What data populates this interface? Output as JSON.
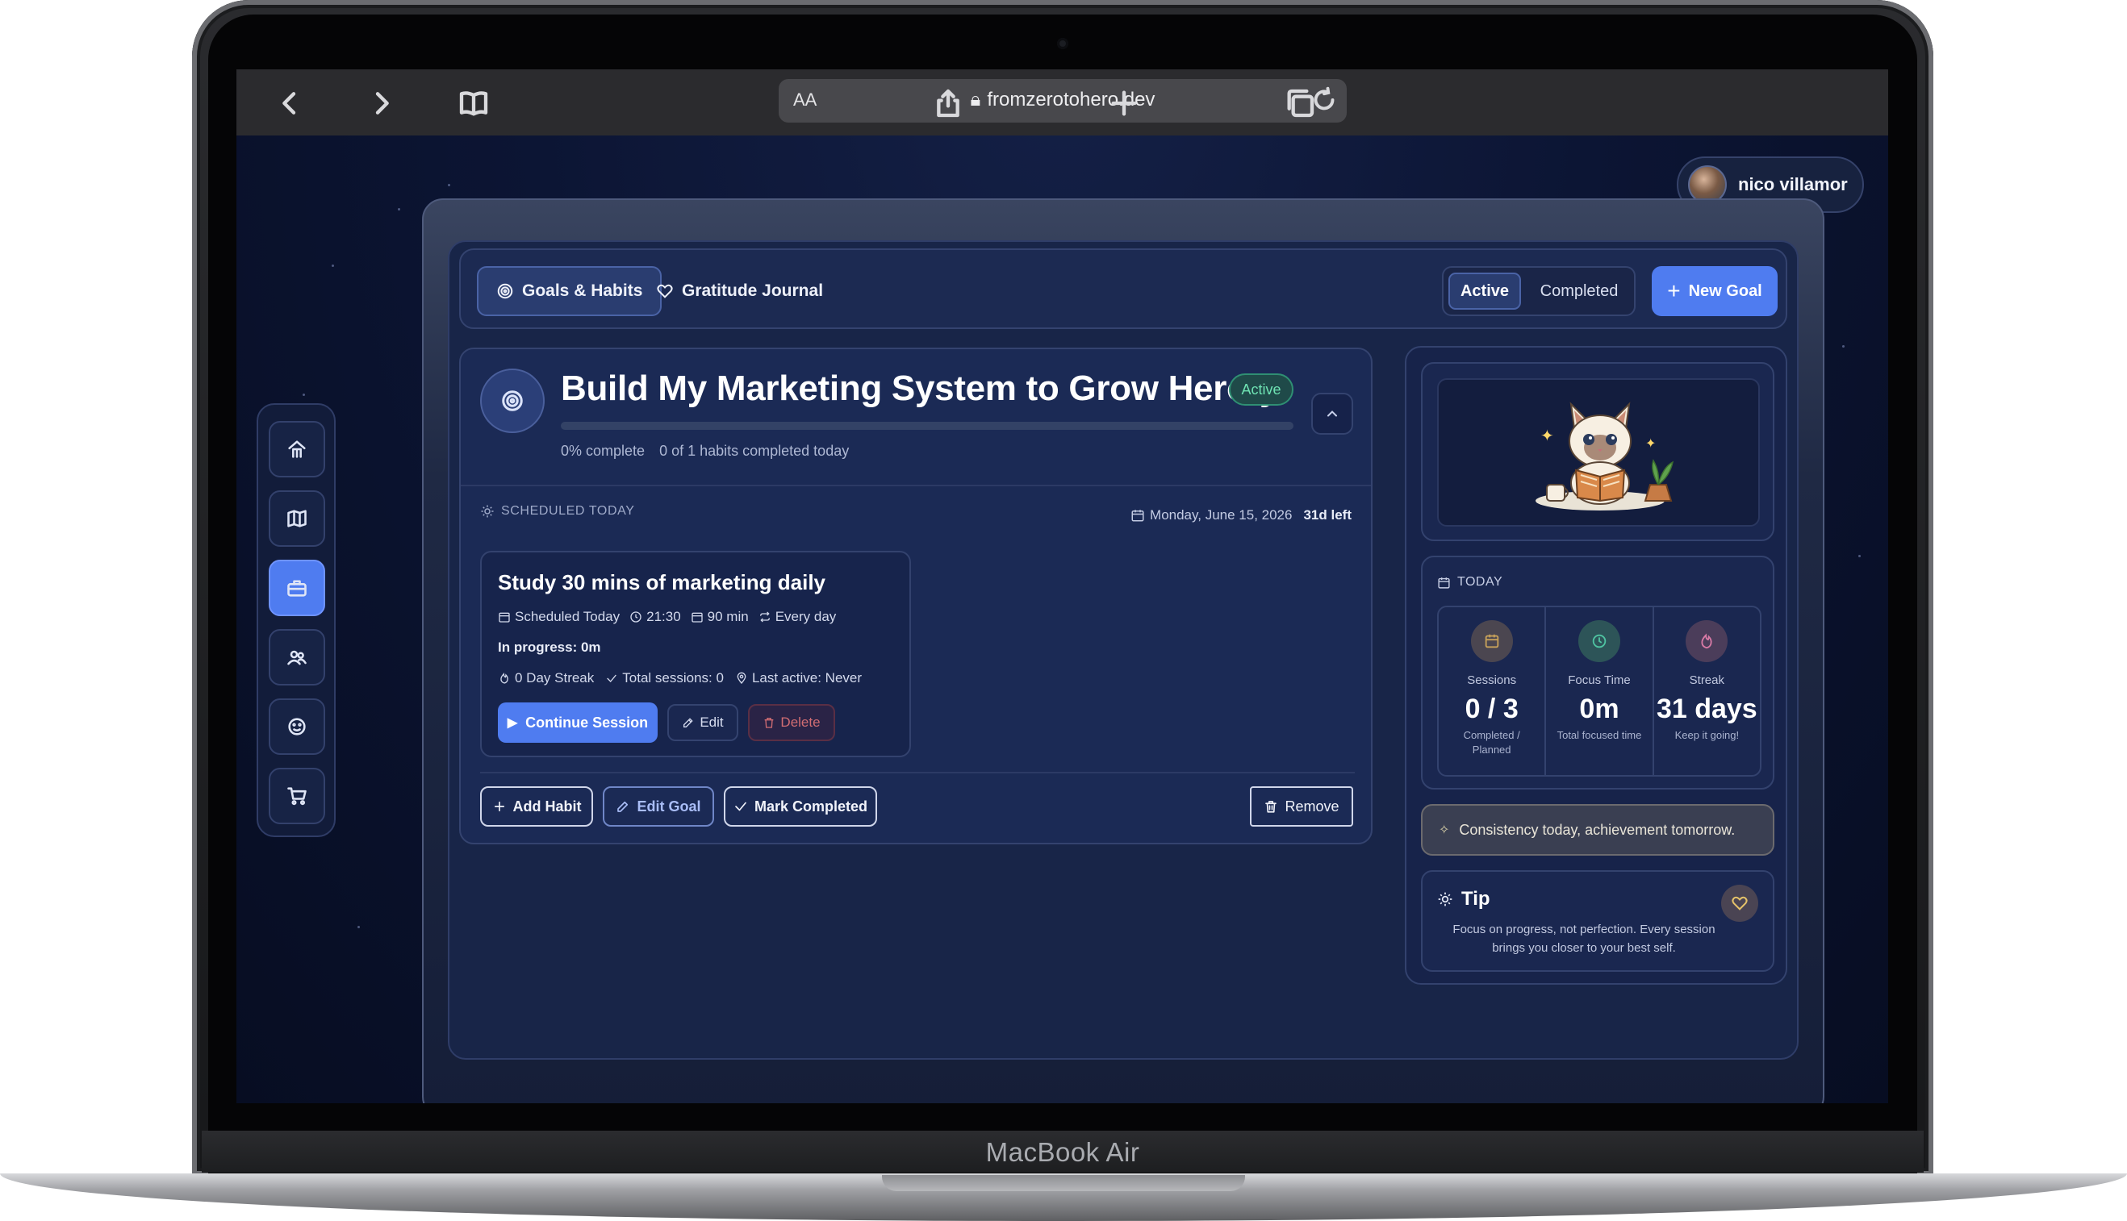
{
  "device": {
    "brand": "MacBook Air"
  },
  "browser": {
    "text_size_label": "AA",
    "url": "fromzerotohero.dev",
    "icons": [
      "back-icon",
      "forward-icon",
      "bookmarks-icon",
      "lock-icon",
      "reload-icon",
      "share-icon",
      "new-tab-icon",
      "tabs-icon"
    ]
  },
  "user": {
    "name": "nico villamor"
  },
  "sidenav": {
    "items": [
      "home-icon",
      "map-icon",
      "briefcase-icon",
      "people-icon",
      "face-icon",
      "cart-icon"
    ],
    "active_index": 2
  },
  "tabs": {
    "goals_habits": "Goals & Habits",
    "gratitude_journal": "Gratitude Journal",
    "filter_active": "Active",
    "filter_completed": "Completed",
    "new_goal": "New Goal"
  },
  "goal": {
    "title": "Build My Marketing System to Grow Herofy",
    "status": "Active",
    "progress_fraction": 0,
    "percent_label": "0% complete",
    "habits_today": "0 of 1 habits completed today",
    "scheduled_label": "SCHEDULED TODAY",
    "date": "Monday, June 15, 2026",
    "time_left": "31d left",
    "habit": {
      "title": "Study 30 mins of marketing daily",
      "scheduled": "Scheduled Today",
      "time": "21:30",
      "duration": "90 min",
      "frequency": "Every day",
      "in_progress": "In progress: 0m",
      "streak": "0 Day Streak",
      "sessions": "Total sessions: 0",
      "last_active": "Last active: Never",
      "continue_label": "Continue Session",
      "edit_label": "Edit",
      "delete_label": "Delete"
    },
    "actions": {
      "add_habit": "Add Habit",
      "edit_goal": "Edit Goal",
      "mark_completed": "Mark Completed",
      "remove": "Remove"
    }
  },
  "today": {
    "label": "TODAY",
    "stats": [
      {
        "name": "Sessions",
        "value": "0 / 3",
        "sub": "Completed / Planned",
        "icon": "calendar-icon",
        "color": "#c7a15a"
      },
      {
        "name": "Focus Time",
        "value": "0m",
        "sub": "Total focused time",
        "icon": "clock-icon",
        "color": "#4fc3a1"
      },
      {
        "name": "Streak",
        "value": "31 days",
        "sub": "Keep it going!",
        "icon": "flame-icon",
        "color": "#d87aa6"
      }
    ]
  },
  "quote": "Consistency today, achievement tomorrow.",
  "tip": {
    "title": "Tip",
    "text": "Focus on progress, not perfection. Every session brings you closer to your best self."
  },
  "colors": {
    "accent": "#4f7cf0",
    "background": "#0c1534",
    "active_badge": "#6fe3b3",
    "delete": "#d16d73"
  }
}
